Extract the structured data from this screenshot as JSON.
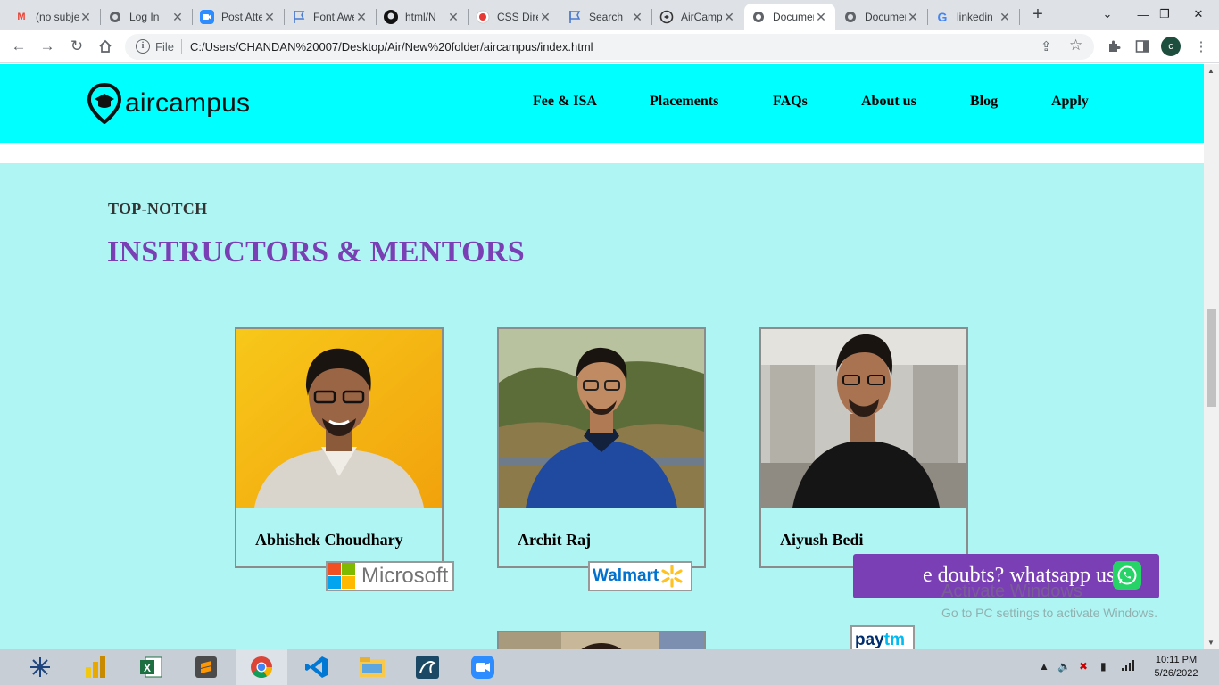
{
  "browser": {
    "tabs": [
      {
        "title": "(no subject)",
        "icon": "gmail-icon"
      },
      {
        "title": "Log In",
        "icon": "globe-icon"
      },
      {
        "title": "Post Attendee",
        "icon": "zoom-icon"
      },
      {
        "title": "Font Awesome",
        "icon": "flag-icon"
      },
      {
        "title": "html/N",
        "icon": "github-icon"
      },
      {
        "title": "CSS Direction",
        "icon": "record-icon"
      },
      {
        "title": "Search",
        "icon": "flag-icon"
      },
      {
        "title": "AirCampus",
        "icon": "aircampus-icon"
      },
      {
        "title": "Document",
        "icon": "globe-icon",
        "active": true
      },
      {
        "title": "Document",
        "icon": "globe-icon"
      },
      {
        "title": "linkedin",
        "icon": "google-icon"
      }
    ],
    "omnibox": {
      "scheme_label": "File",
      "url": "C:/Users/CHANDAN%20007/Desktop/Air/New%20folder/aircampus/index.html"
    },
    "profile_initial": "c"
  },
  "site": {
    "logo_text": "aircampus",
    "nav": [
      "Fee & ISA",
      "Placements",
      "FAQs",
      "About us",
      "Blog",
      "Apply"
    ]
  },
  "section": {
    "eyebrow": "TOP-NOTCH",
    "heading": "INSTRUCTORS & MENTORS"
  },
  "mentors": [
    {
      "name": "Abhishek Choudhary",
      "company": "Microsoft"
    },
    {
      "name": "Archit Raj",
      "company": "Walmart"
    },
    {
      "name": "Aiyush Bedi",
      "company": "paytm"
    }
  ],
  "whatsapp": {
    "label": "e doubts? whatsapp us"
  },
  "watermark": {
    "line1": "Activate Windows",
    "line2": "Go to PC settings to activate Windows."
  },
  "taskbar": {
    "time": "10:11 PM",
    "date": "5/26/2022"
  },
  "colors": {
    "nav_bg": "#00ffff",
    "section_bg": "#aff5f3",
    "heading": "#7a3fb5",
    "whatsapp_bg": "#7a3fb5"
  }
}
